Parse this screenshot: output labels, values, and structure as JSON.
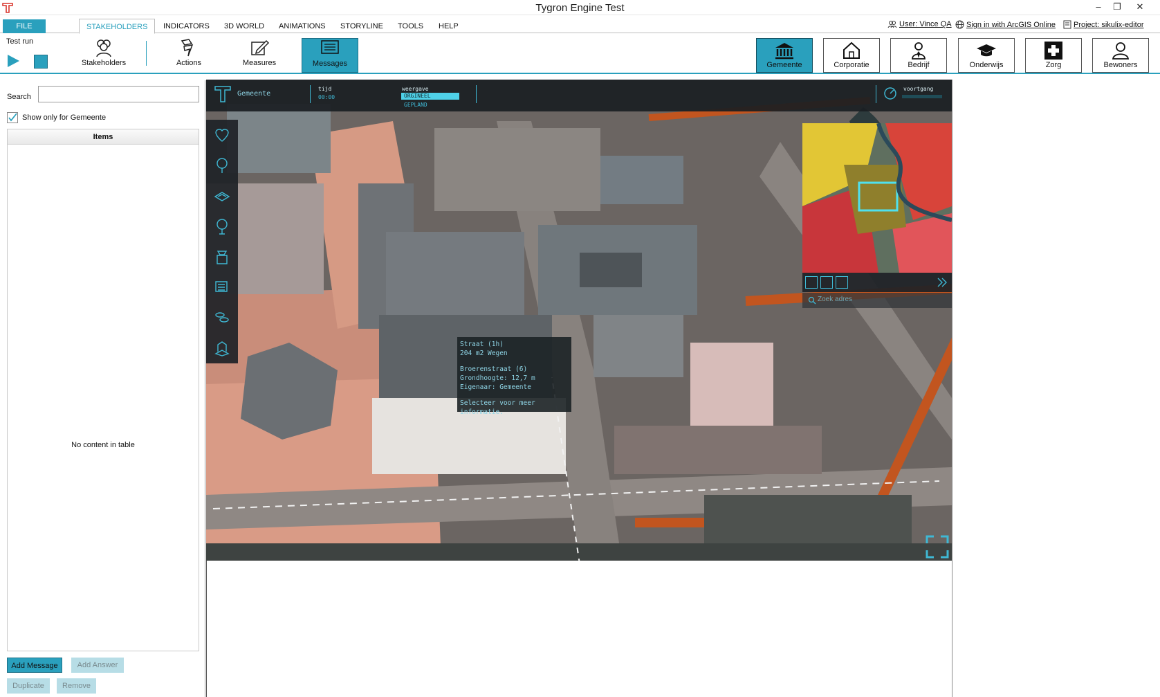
{
  "window": {
    "title": "Tygron Engine Test",
    "minimize": "–",
    "restore": "❐",
    "close": "✕"
  },
  "menu": {
    "file": "FILE",
    "tabs": [
      "STAKEHOLDERS",
      "INDICATORS",
      "3D WORLD",
      "ANIMATIONS",
      "STORYLINE",
      "TOOLS",
      "HELP"
    ],
    "active_tab": "STAKEHOLDERS",
    "user": "User: Vince QA",
    "arcgis": "Sign in with ArcGIS Online",
    "project": "Project: sikulix-editor"
  },
  "ribbon": {
    "test_run": "Test run",
    "tools": [
      "Stakeholders",
      "Actions",
      "Measures",
      "Messages"
    ],
    "active_tool": "Messages",
    "stakeholders": [
      "Gemeente",
      "Corporatie",
      "Bedrijf",
      "Onderwijs",
      "Zorg",
      "Bewoners"
    ],
    "active_stakeholder": "Gemeente",
    "accent": "#2aa0bd"
  },
  "left": {
    "search_label": "Search",
    "search_value": "",
    "show_only": "Show only for Gemeente",
    "show_only_checked": true,
    "items_header": "Items",
    "empty": "No content in table",
    "buttons": {
      "add_message": "Add Message",
      "add_answer": "Add Answer",
      "duplicate": "Duplicate",
      "remove": "Remove"
    }
  },
  "viewer": {
    "hud": {
      "stakeholder": "Gemeente",
      "tijd_label": "tijd",
      "tijd_value": "00:00",
      "weergave_label": "weergave",
      "orgineel": "ORGINEEL",
      "gepland": "GEPLAND",
      "voortgang": "voortgang"
    },
    "tooltip": {
      "line1": "Straat (1h)",
      "line2": "204 m2 Wegen",
      "line3": "Broerenstraat (6)",
      "line4": "Grondhoogte: 12,7 m",
      "line5": "Eigenaar: Gemeente",
      "line6": "Selecteer voor meer informatie."
    },
    "search_placeholder": "Zoek adres"
  }
}
